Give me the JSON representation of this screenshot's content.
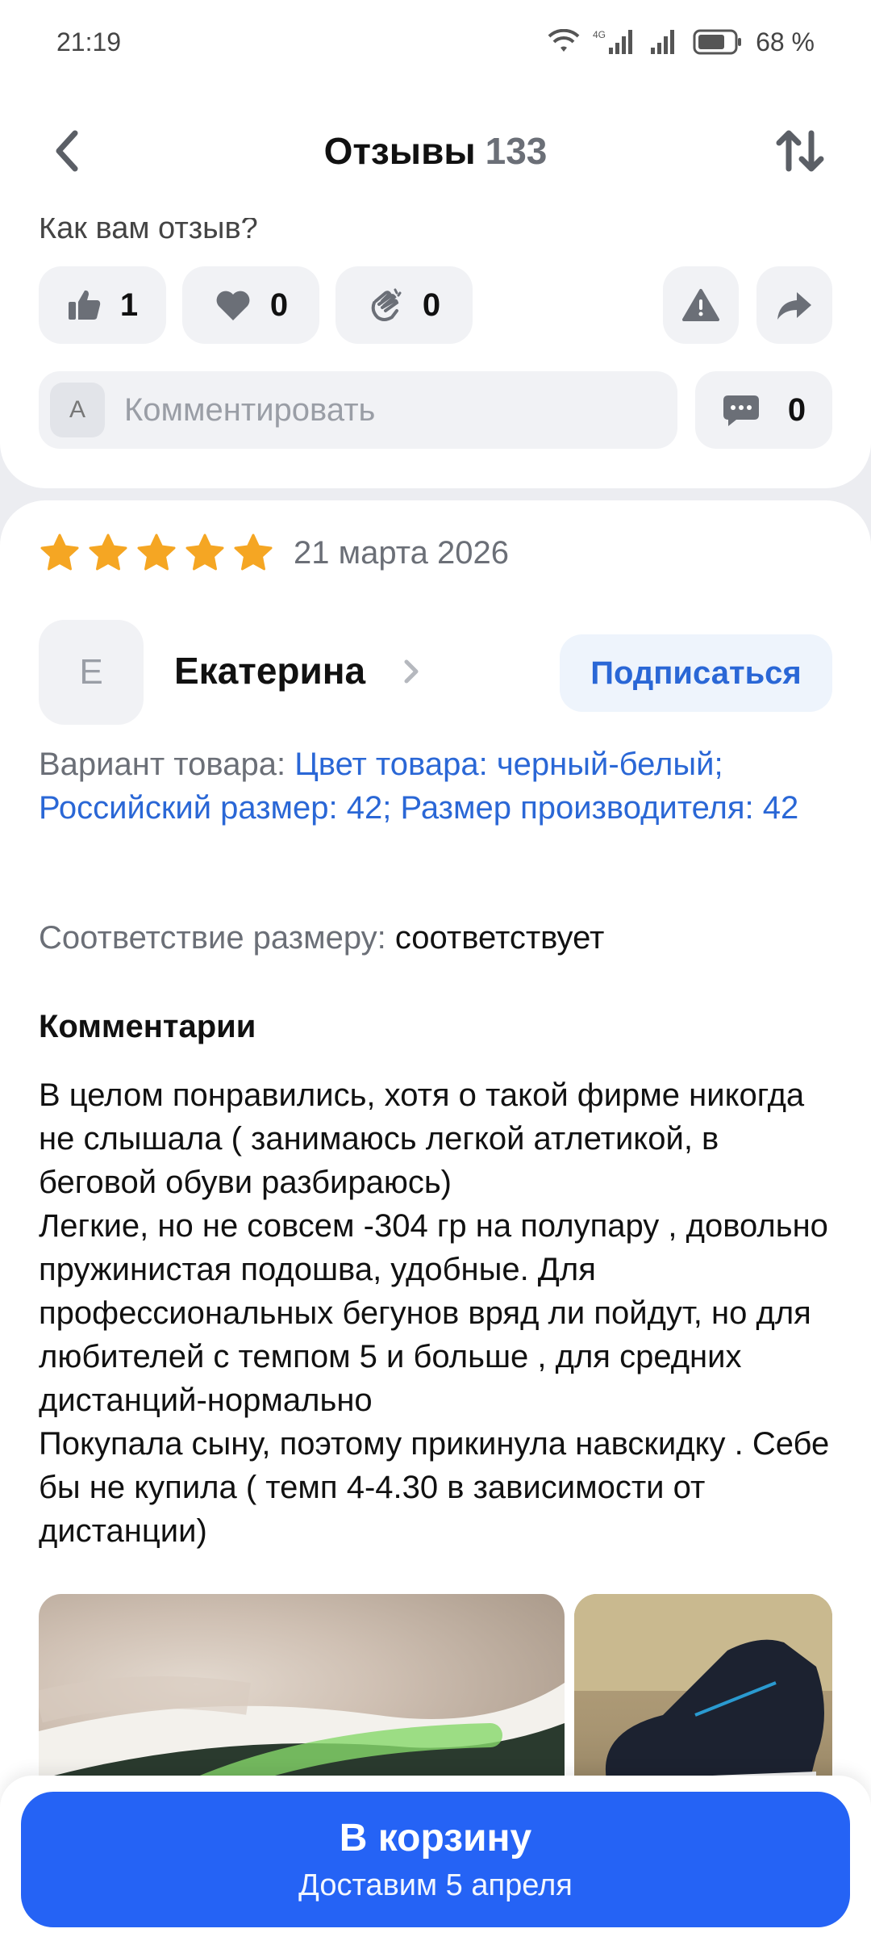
{
  "status_bar": {
    "time": "21:19",
    "battery_percent": "68 %",
    "network_label": "4G"
  },
  "header": {
    "title": "Отзывы",
    "count": "133",
    "back_icon": "chevron-left-icon",
    "sort_icon": "sort-arrows-icon"
  },
  "prev_review": {
    "how_text": "Как вам отзыв?",
    "likes": "1",
    "hearts": "0",
    "claps": "0",
    "comment_avatar": "А",
    "comment_placeholder": "Комментировать",
    "comment_count": "0"
  },
  "review": {
    "rating": 5,
    "date": "21 марта 2026",
    "author_initial": "Е",
    "author_name": "Екатерина",
    "subscribe_label": "Подписаться",
    "variant_label": "Вариант товара:",
    "variant_value": "Цвет товара: черный-белый; Российский размер: 42; Размер производителя: 42",
    "size_fit_label": "Соответствие размеру:",
    "size_fit_value": "соответствует",
    "comments_title": "Комментарии",
    "text": "В целом понравились, хотя о такой фирме никогда не слышала ( занимаюсь легкой атлетикой, в беговой обуви разбираюсь)\nЛегкие, но не совсем -304 гр на полупару , довольно пружинистая подошва, удобные. Для профессиональных бегунов вряд ли пойдут, но для любителей с темпом 5 и больше , для средних дистанций-нормально\nПокупала сыну, поэтому прикинула навскидку . Себе бы не купила ( темп 4-4.30 в зависимости от дистанции)"
  },
  "bottom": {
    "cart_label": "В корзину",
    "delivery_text": "Доставим 5 апреля"
  },
  "colors": {
    "accent": "#2563f5",
    "link": "#2a67d6",
    "star": "#f5a623"
  }
}
